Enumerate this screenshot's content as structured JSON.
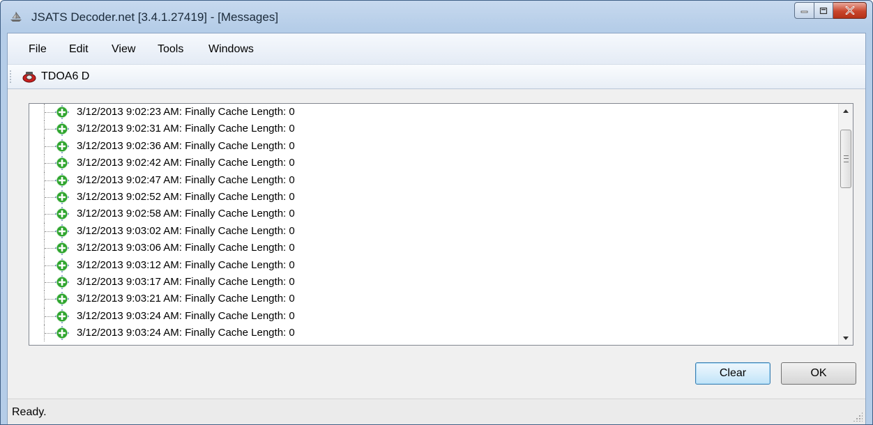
{
  "window": {
    "title": "JSATS Decoder.net [3.4.1.27419] - [Messages]",
    "icons": [
      "app-icon",
      "minimize-icon",
      "maximize-icon",
      "close-icon"
    ]
  },
  "menu": {
    "items": [
      "File",
      "Edit",
      "View",
      "Tools",
      "Windows"
    ]
  },
  "toolbar": {
    "button_label": "TDOA6 D",
    "button_icon": "receiver-icon"
  },
  "messages": {
    "row_icon": "expand-node-icon",
    "rows": [
      "3/12/2013 9:02:23 AM: Finally Cache Length: 0",
      "3/12/2013 9:02:31 AM: Finally Cache Length: 0",
      "3/12/2013 9:02:36 AM: Finally Cache Length: 0",
      "3/12/2013 9:02:42 AM: Finally Cache Length: 0",
      "3/12/2013 9:02:47 AM: Finally Cache Length: 0",
      "3/12/2013 9:02:52 AM: Finally Cache Length: 0",
      "3/12/2013 9:02:58 AM: Finally Cache Length: 0",
      "3/12/2013 9:03:02 AM: Finally Cache Length: 0",
      "3/12/2013 9:03:06 AM: Finally Cache Length: 0",
      "3/12/2013 9:03:12 AM: Finally Cache Length: 0",
      "3/12/2013 9:03:17 AM: Finally Cache Length: 0",
      "3/12/2013 9:03:21 AM: Finally Cache Length: 0",
      "3/12/2013 9:03:24 AM: Finally Cache Length: 0",
      "3/12/2013 9:03:24 AM: Finally Cache Length: 0"
    ]
  },
  "buttons": {
    "clear": "Clear",
    "ok": "OK"
  },
  "status": {
    "text": "Ready."
  },
  "colors": {
    "titlebar": "#b5cde8",
    "close_button": "#c9462c",
    "node_green": "#2fa52f",
    "node_blue": "#1f4fa0"
  }
}
